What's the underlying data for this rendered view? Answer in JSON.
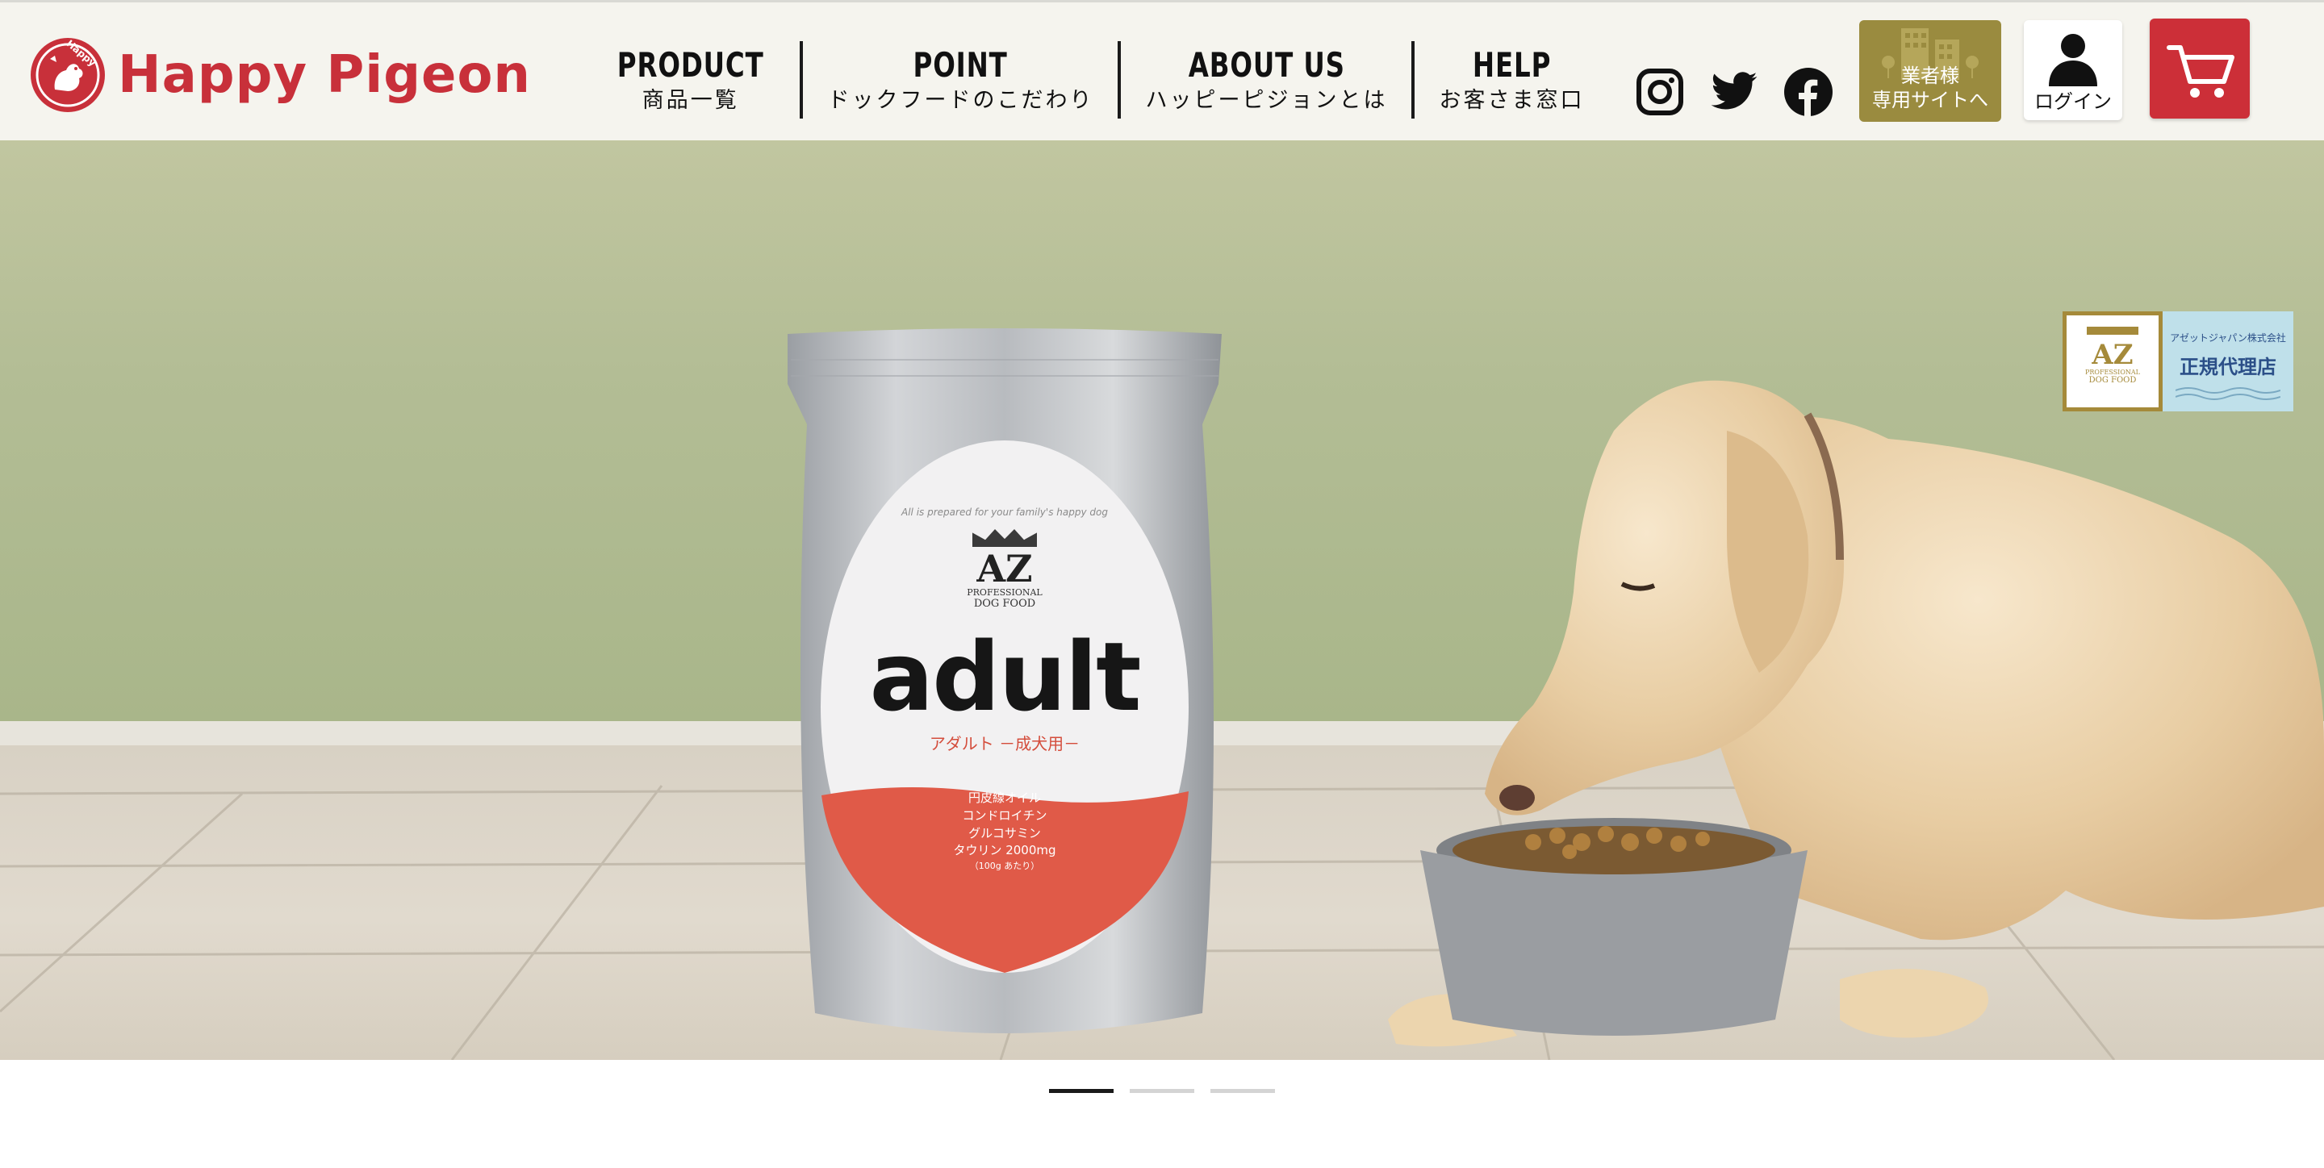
{
  "brand": {
    "name": "Happy Pigeon",
    "badge_text": "Happy",
    "color": "#c8303a"
  },
  "nav": {
    "items": [
      {
        "en": "PRODUCT",
        "ja": "商品一覧"
      },
      {
        "en": "POINT",
        "ja": "ドックフードのこだわり"
      },
      {
        "en": "ABOUT US",
        "ja": "ハッピーピジョンとは"
      },
      {
        "en": "HELP",
        "ja": "お客さま窓口"
      }
    ]
  },
  "social": {
    "icons": [
      "instagram-icon",
      "twitter-icon",
      "facebook-icon"
    ]
  },
  "header_buttons": {
    "business_line1": "業者様",
    "business_line2": "専用サイトへ",
    "login": "ログイン",
    "cart_icon": "cart-icon"
  },
  "hero": {
    "product": {
      "brand_mark": "AZ",
      "brand_sub1": "PROFESSIONAL",
      "brand_sub2": "DOG FOOD",
      "name": "adult",
      "name_ja": "アダルト －成犬用－",
      "tagline": "All is prepared for your family's happy dog",
      "ingredients": [
        "円皮線オイル",
        "コンドロイチン",
        "グルコサミン",
        "タウリン 2000mg",
        "（100g あたり）"
      ]
    },
    "partner": {
      "az_mark": "AZ",
      "az_sub1": "PROFESSIONAL",
      "az_sub2": "DOG FOOD",
      "company": "アゼットジャパン株式会社",
      "label": "正規代理店"
    }
  },
  "pager": {
    "count": 3,
    "active": 0
  },
  "colors": {
    "header_bg": "#f5f4ee",
    "business_btn": "#9a8b3f",
    "cart_btn": "#cc2f38",
    "partner_bg": "#bfe0ea"
  }
}
